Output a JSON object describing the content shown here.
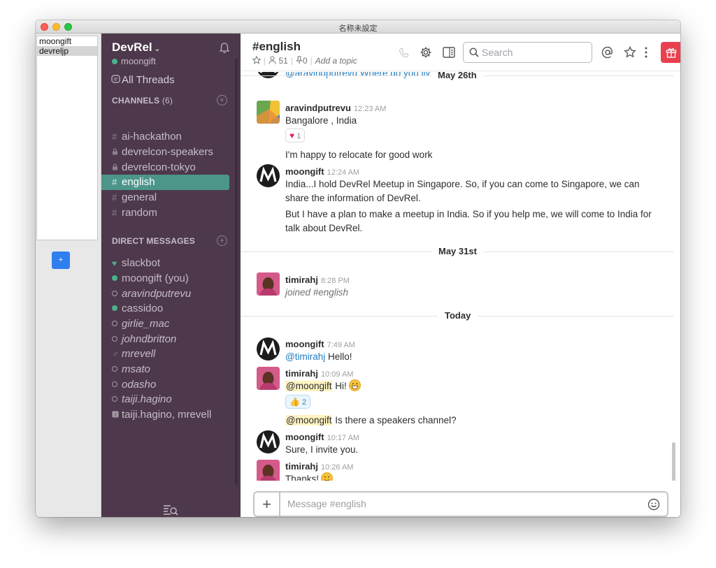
{
  "window": {
    "title": "名称未設定"
  },
  "teams": {
    "items": [
      "moongift",
      "devreljp"
    ],
    "add_label": "+"
  },
  "sidebar": {
    "workspace": "DevRel",
    "workspace_caret": "⌄",
    "user": "moongift",
    "all_threads": "All Threads",
    "channels_label": "CHANNELS",
    "channels_count": "(6)",
    "channels": [
      {
        "prefix": "#",
        "name": "ai-hackathon"
      },
      {
        "prefix": "🔒",
        "name": "devrelcon-speakers"
      },
      {
        "prefix": "🔒",
        "name": "devrelcon-tokyo"
      },
      {
        "prefix": "#",
        "name": "english"
      },
      {
        "prefix": "#",
        "name": "general"
      },
      {
        "prefix": "#",
        "name": "random"
      }
    ],
    "dm_label": "DIRECT MESSAGES",
    "dms": [
      "slackbot",
      "moongift (you)",
      "aravindputrevu",
      "cassidoo",
      "girlie_mac",
      "johndbritton",
      "mrevell",
      "msato",
      "odasho",
      "taiji.hagino",
      "taiji.hagino, mrevell"
    ]
  },
  "header": {
    "channel": "#english",
    "members": "51",
    "pins": "0",
    "topic_placeholder": "Add a topic",
    "search_placeholder": "Search"
  },
  "messages": {
    "partial_top": "@aravindputrevu Where do you liv",
    "day_may26": "May 26th",
    "m1_name": "aravindputrevu",
    "m1_time": "12:23 AM",
    "m1_text": "Bangalore , India",
    "m1_reaction_count": "1",
    "m1_text2": "I'm happy to relocate for good work",
    "m2_name": "moongift",
    "m2_time": "12:24 AM",
    "m2_text": "India...I hold DevRel Meetup in Singapore. So, if you can come to Singapore, we can share the information of DevRel.",
    "m2_text2": "But I have a plan to make a meetup in India. So if you help me, we will come to India for talk about DevRel.",
    "day_may31": "May 31st",
    "m3_name": "timirahj",
    "m3_time": "8:28 PM",
    "m3_text": "joined #english",
    "day_today": "Today",
    "m4_name": "moongift",
    "m4_time": "7:49 AM",
    "m4_mention": "@timirahj",
    "m4_text": " Hello!",
    "m5_name": "timirahj",
    "m5_time": "10:09 AM",
    "m5_mention": "@moongift",
    "m5_text": " Hi!",
    "m5_reaction_count": "2",
    "m5_mention2": "@moongift",
    "m5_text2": " Is there a speakers channel?",
    "m6_name": "moongift",
    "m6_time": "10:17 AM",
    "m6_text": "Sure, I invite you.",
    "m7_name": "timirahj",
    "m7_time": "10:26 AM",
    "m7_text": "Thanks!"
  },
  "composer": {
    "placeholder": "Message #english",
    "plus": "+"
  },
  "colors": {
    "sidebar_bg": "#4d394b",
    "active_channel": "#4c9689",
    "presence": "#4ab28d",
    "gift": "#e8404f",
    "mention": "#1f7abf"
  },
  "icons": [
    "bell-icon",
    "threads-icon",
    "lock-icon",
    "heart-icon",
    "star-icon",
    "person-icon",
    "pin-icon",
    "phone-icon",
    "gear-icon",
    "sidebar-toggle-icon",
    "search-icon",
    "at-icon",
    "more-icon",
    "gift-icon",
    "filter-icon",
    "smiley-icon"
  ]
}
